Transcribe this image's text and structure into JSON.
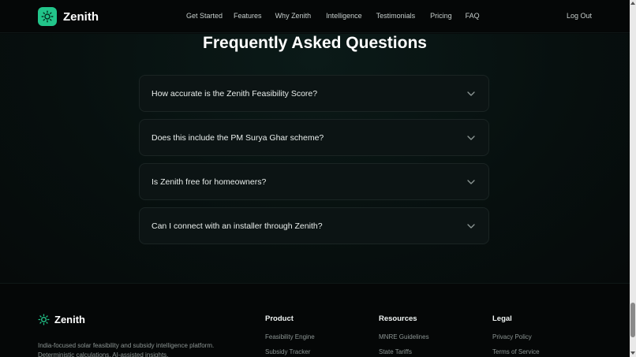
{
  "nav": {
    "brand": "Zenith",
    "brand_icon": "sun-icon",
    "links": [
      "Get Started",
      "Features",
      "Why Zenith",
      "Intelligence",
      "Testimonials",
      "Pricing",
      "FAQ"
    ],
    "logout": "Log Out"
  },
  "faq": {
    "title": "Frequently Asked Questions",
    "items": [
      {
        "question": "How accurate is the Zenith Feasibility Score?",
        "icon": "chevron-down-icon"
      },
      {
        "question": "Does this include the PM Surya Ghar scheme?",
        "icon": "chevron-down-icon"
      },
      {
        "question": "Is Zenith free for homeowners?",
        "icon": "chevron-down-icon"
      },
      {
        "question": "Can I connect with an installer through Zenith?",
        "icon": "chevron-down-icon"
      }
    ]
  },
  "footer": {
    "brand": "Zenith",
    "description": "India-focused solar feasibility and subsidy intelligence platform. Deterministic calculations. AI-assisted insights.",
    "columns": [
      {
        "heading": "Product",
        "links": [
          "Feasibility Engine",
          "Subsidy Tracker"
        ]
      },
      {
        "heading": "Resources",
        "links": [
          "MNRE Guidelines",
          "State Tariffs"
        ]
      },
      {
        "heading": "Legal",
        "links": [
          "Privacy Policy",
          "Terms of Service"
        ]
      }
    ]
  },
  "colors": {
    "accent": "#22c58a",
    "background": "#060a0a",
    "card": "#0c1414"
  }
}
